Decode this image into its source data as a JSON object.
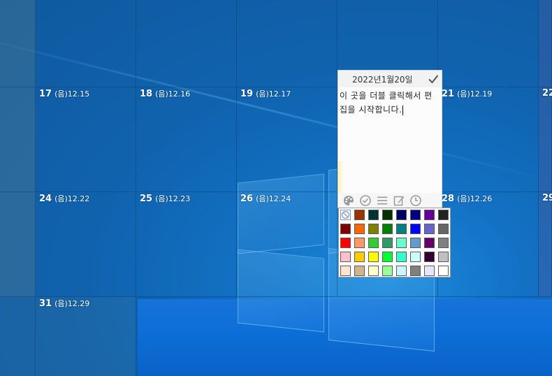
{
  "calendar": {
    "cells": [
      {
        "day": "",
        "lunar": ""
      },
      {
        "day": "",
        "lunar": ""
      },
      {
        "day": "",
        "lunar": ""
      },
      {
        "day": "",
        "lunar": ""
      },
      {
        "day": "",
        "lunar": ""
      },
      {
        "day": "",
        "lunar": ""
      },
      {
        "day": "",
        "lunar": ""
      },
      {
        "day": "",
        "lunar": ""
      },
      {
        "day": "17",
        "lunar": "(음)12.15"
      },
      {
        "day": "18",
        "lunar": "(음)12.16"
      },
      {
        "day": "19",
        "lunar": "(음)12.17"
      },
      {
        "day": "",
        "lunar": ""
      },
      {
        "day": "21",
        "lunar": "(음)12.19"
      },
      {
        "day": "22",
        "lunar": ""
      },
      {
        "day": "",
        "lunar": ""
      },
      {
        "day": "24",
        "lunar": "(음)12.22"
      },
      {
        "day": "25",
        "lunar": "(음)12.23"
      },
      {
        "day": "26",
        "lunar": "(음)12.24"
      },
      {
        "day": "",
        "lunar": ""
      },
      {
        "day": "28",
        "lunar": "(음)12.26"
      },
      {
        "day": "29",
        "lunar": ""
      },
      {
        "day": "",
        "lunar": ""
      },
      {
        "day": "31",
        "lunar": "(음)12.29"
      }
    ]
  },
  "memo": {
    "date": "2022년1월20일",
    "text": "이 곳을 더블 클릭해서 편집을 시작합니다.",
    "icons": {
      "confirm": "check-icon",
      "toolbar": [
        "palette-icon",
        "check-circle-icon",
        "menu-lines-icon",
        "edit-icon",
        "clock-icon"
      ]
    }
  },
  "palette": {
    "colors": [
      [
        "none",
        "#993300",
        "#003333",
        "#003300",
        "#000066",
        "#000080",
        "#660099",
        "#222222"
      ],
      [
        "#800000",
        "#ff6600",
        "#808000",
        "#008000",
        "#008080",
        "#0000ff",
        "#6666cc",
        "#666666"
      ],
      [
        "#ff0000",
        "#ff9966",
        "#33cc33",
        "#339966",
        "#66ffcc",
        "#6699cc",
        "#660066",
        "#808080"
      ],
      [
        "#ffc0cb",
        "#ffcc00",
        "#ffff00",
        "#00ff33",
        "#33ffcc",
        "#ccffff",
        "#330033",
        "#c0c0c0"
      ],
      [
        "#ffe4d4",
        "#d2b48c",
        "#ffffcc",
        "#99ff99",
        "#ccf5ff",
        "#808080",
        "#e6e6ff",
        "#ffffff"
      ]
    ]
  }
}
